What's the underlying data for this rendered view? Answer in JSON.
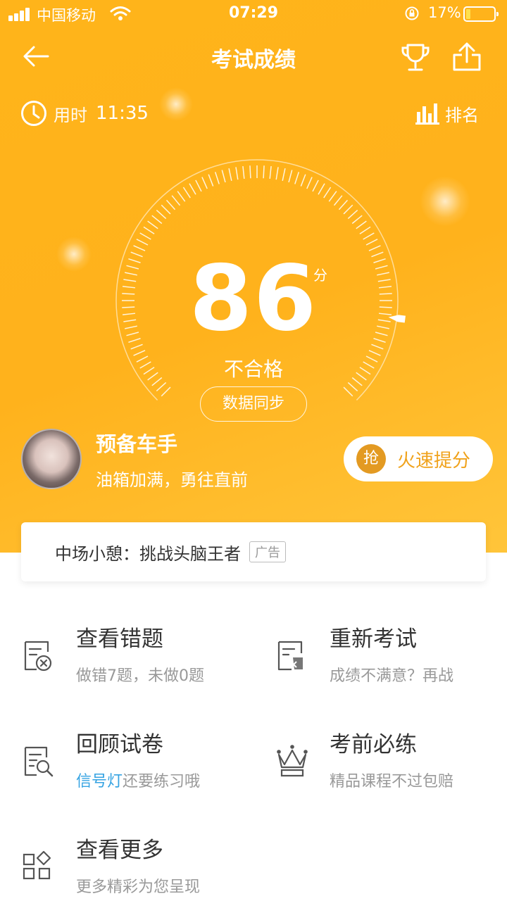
{
  "status_bar": {
    "carrier": "中国移动",
    "time": "07:29",
    "battery_percent": "17%",
    "battery_level": 0.17
  },
  "header": {
    "title": "考试成绩",
    "icons": [
      "back-arrow-icon",
      "trophy-icon",
      "share-icon"
    ]
  },
  "stats": {
    "time_label": "用时",
    "time_value": "11:35",
    "rank_label": "排名"
  },
  "score": {
    "value": "86",
    "unit": "分",
    "result": "不合格",
    "gauge_fraction": 0.86,
    "sync_label": "数据同步"
  },
  "user": {
    "name": "预备车手",
    "slogan": "油箱加满，勇往直前",
    "boost_badge": "抢",
    "boost_label": "火速提分"
  },
  "ad": {
    "text": "中场小憩：挑战头脑王者",
    "tag": "广告"
  },
  "menu": [
    {
      "title": "查看错题",
      "subtitle": "做错7题，未做0题",
      "icon": "wrong-questions-icon"
    },
    {
      "title": "重新考试",
      "subtitle": "成绩不满意？再战",
      "icon": "retake-exam-icon"
    },
    {
      "title": "回顾试卷",
      "subtitle_highlight": "信号灯",
      "subtitle_rest": "还要练习哦",
      "icon": "review-paper-icon"
    },
    {
      "title": "考前必练",
      "subtitle": "精品课程不过包赔",
      "icon": "crown-icon"
    },
    {
      "title": "查看更多",
      "subtitle": "更多精彩为您呈现",
      "icon": "more-apps-icon"
    }
  ],
  "colors": {
    "hero_orange": "#ffb41a",
    "accent_orange": "#f0a21b",
    "link_blue": "#35a3e2",
    "muted_gray": "#999999"
  }
}
